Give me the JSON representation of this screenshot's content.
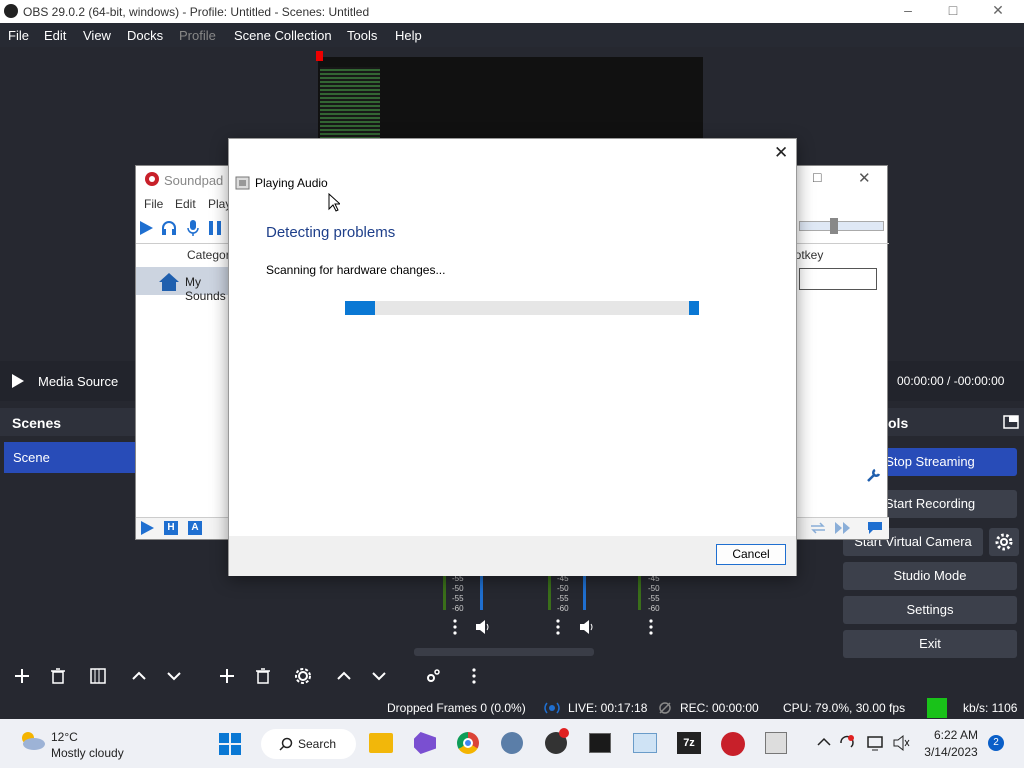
{
  "window": {
    "title": "OBS 29.0.2 (64-bit, windows) - Profile: Untitled - Scenes: Untitled"
  },
  "menu": [
    "File",
    "Edit",
    "View",
    "Docks",
    "Profile",
    "Scene Collection",
    "Tools",
    "Help"
  ],
  "source_bar": {
    "source_name": "Media Source",
    "time": "00:00:00  /  -00:00:00"
  },
  "scenes": {
    "header": "Scenes",
    "items": [
      "Scene"
    ]
  },
  "controls": {
    "header": "ols",
    "stop_streaming": "Stop Streaming",
    "start_recording": "Start Recording",
    "start_virtual_camera": "Start Virtual Camera",
    "studio_mode": "Studio Mode",
    "settings": "Settings",
    "exit": "Exit"
  },
  "mixer": {
    "ticks1": [
      "-55",
      "-50",
      "-55",
      "-60"
    ],
    "ticks2": [
      "-45",
      "-50",
      "-55",
      "-60"
    ],
    "ticks3": [
      "-45",
      "-50",
      "-55",
      "-60"
    ]
  },
  "status": {
    "dropped": "Dropped Frames 0 (0.0%)",
    "live": "LIVE: 00:17:18",
    "rec": "REC: 00:00:00",
    "cpu": "CPU: 79.0%, 30.00 fps",
    "kbs": "kb/s: 1106"
  },
  "soundpad": {
    "title": "Soundpad",
    "menu": [
      "File",
      "Edit",
      "Play"
    ],
    "col_category": "Category",
    "col_hotkey": "Hotkey",
    "item": "My Sounds"
  },
  "dialog": {
    "title": "Playing Audio",
    "heading": "Detecting problems",
    "message": "Scanning for hardware changes...",
    "cancel": "Cancel"
  },
  "taskbar": {
    "weather_temp": "12°C",
    "weather_desc": "Mostly cloudy",
    "search": "Search",
    "time": "6:22 AM",
    "date": "3/14/2023",
    "badge": "2"
  },
  "colors": {
    "obs_bg": "#262830",
    "accent": "#284cb8",
    "progress": "#0a78d4",
    "live_green": "#19c219"
  }
}
